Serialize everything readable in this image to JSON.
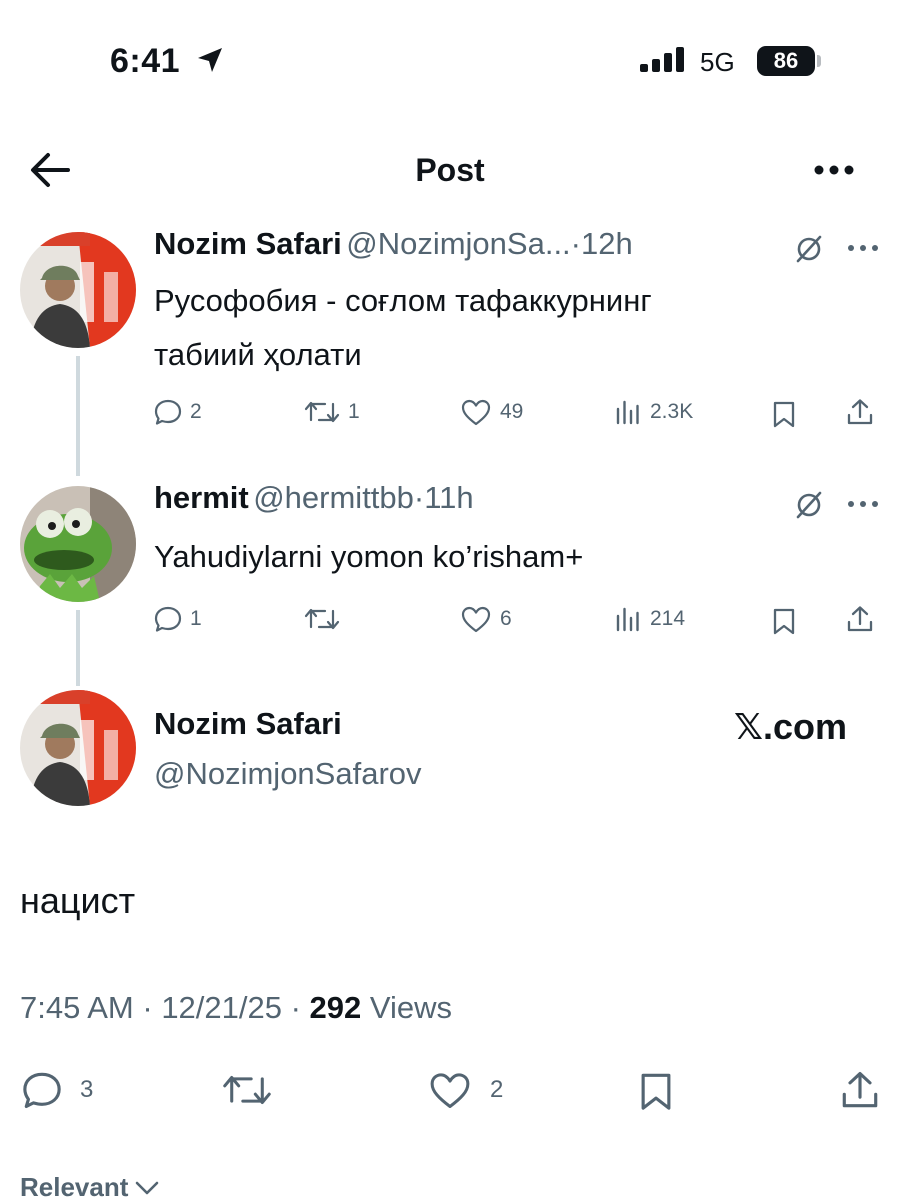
{
  "status_bar": {
    "time": "6:41",
    "network": "5G",
    "battery": "86"
  },
  "header": {
    "title": "Post"
  },
  "tweets": [
    {
      "name": "Nozim Safari",
      "handle": "@NozimjonSa...",
      "sep": "·",
      "time": "12h",
      "text_line1": "Русофобия - соғлом тафаккурнинг",
      "text_line2": "табиий ҳолати",
      "replies": "2",
      "reposts": "1",
      "likes": "49",
      "views": "2.3K"
    },
    {
      "name": "hermit",
      "handle": "@hermittbb",
      "sep": "·",
      "time": "11h",
      "text_line1": "Yahudiylarni yomon ko’risham+",
      "replies": "1",
      "likes": "6",
      "views": "214"
    }
  ],
  "main_post": {
    "name": "Nozim Safari",
    "handle": "@NozimjonSafarov",
    "watermark": "𝕏.com",
    "text": "нацист",
    "time": "7:45 AM",
    "date": "12/21/25",
    "views_count": "292",
    "views_label": "Views",
    "replies": "3",
    "likes": "2"
  },
  "sort": {
    "label": "Relevant"
  },
  "colors": {
    "text": "#0f1419",
    "secondary": "#536471",
    "thread_line": "#cfd9de"
  }
}
